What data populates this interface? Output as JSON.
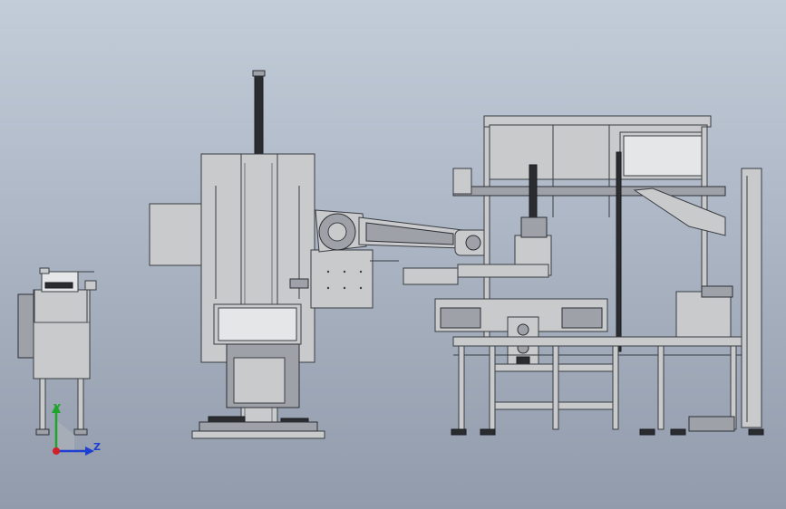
{
  "triad": {
    "y_label": "Y",
    "z_label": "Z",
    "y_color": "#1fa62a",
    "z_color": "#1f3fd0",
    "x_color": "#d0202a"
  },
  "colors": {
    "background_top": "#c3ccd9",
    "background_bottom": "#919bab",
    "metal": "#c8cacc",
    "edge": "#3a3d42"
  },
  "components": [
    "side-feeder-unit",
    "robot-column-cabinet",
    "robot-arm",
    "processing-station-frame"
  ]
}
